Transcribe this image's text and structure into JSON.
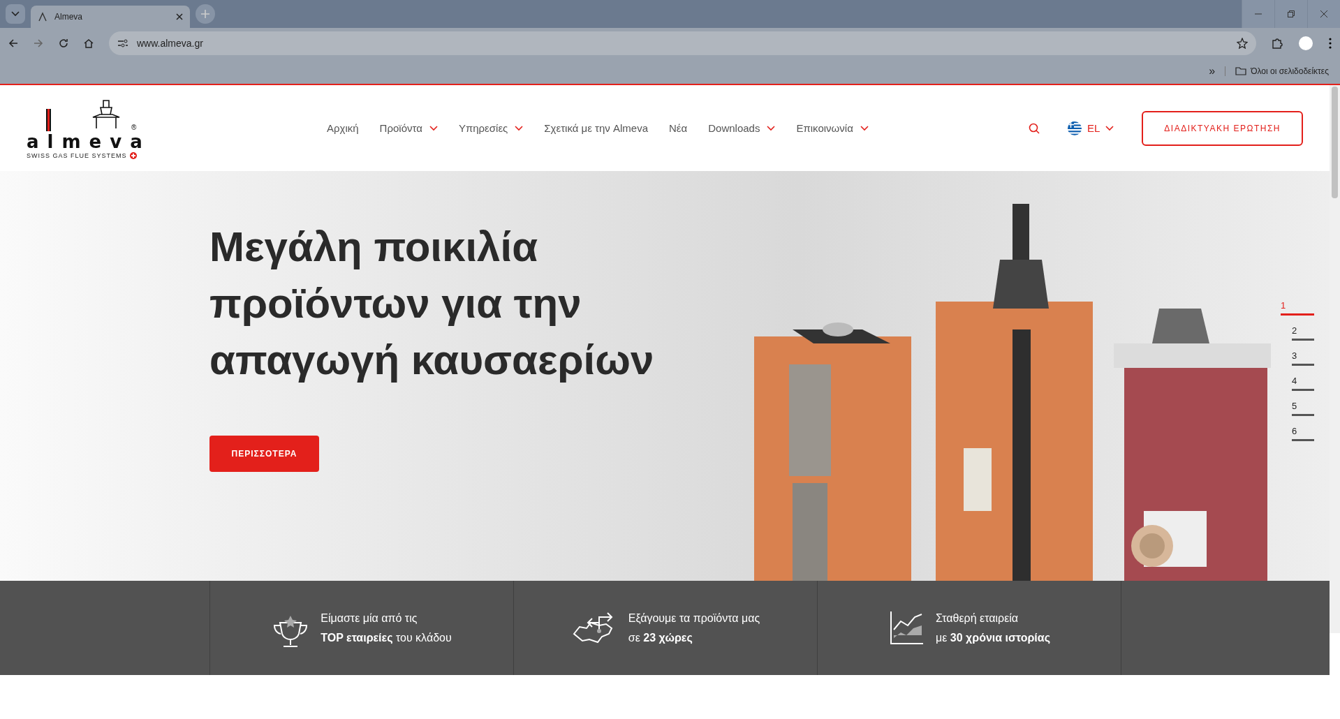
{
  "browser": {
    "tab_title": "Almeva",
    "url": "www.almeva.gr",
    "bookmarks_label": "Όλοι οι σελιδοδείκτες",
    "overflow": "»"
  },
  "logo": {
    "wordmark": "almeva",
    "registered": "®",
    "tagline": "SWISS GAS FLUE SYSTEMS"
  },
  "nav": [
    {
      "label": "Αρχική",
      "dropdown": false
    },
    {
      "label": "Προϊόντα",
      "dropdown": true
    },
    {
      "label": "Υπηρεσίες",
      "dropdown": true
    },
    {
      "label": "Σχετικά με την Almeva",
      "dropdown": false
    },
    {
      "label": "Νέα",
      "dropdown": false
    },
    {
      "label": "Downloads",
      "dropdown": true
    },
    {
      "label": "Επικοινωνία",
      "dropdown": true
    }
  ],
  "language": "EL",
  "cta": "ΔΙΑΔΙΚΤΥΑΚΗ ΕΡΩΤΗΣΗ",
  "hero": {
    "title": "Μεγάλη ποικιλία προϊόντων για την απαγωγή καυσαερίων",
    "button": "ΠΕΡΙΣΣΟΤΕΡΑ"
  },
  "slides": [
    {
      "label": "1",
      "selected": true
    },
    {
      "label": "2",
      "selected": false
    },
    {
      "label": "3",
      "selected": false
    },
    {
      "label": "4",
      "selected": false
    },
    {
      "label": "5",
      "selected": false
    },
    {
      "label": "6",
      "selected": false
    }
  ],
  "stats": [
    {
      "kind": "trophy",
      "line1": "Είμαστε μία από τις",
      "line2": "**TOP εταιρείες** του κλάδου"
    },
    {
      "kind": "map",
      "line1": "Εξάγουμε τα προϊόντα μας",
      "line2": "σε **23 χώρες**"
    },
    {
      "kind": "chart",
      "line1": "Σταθερή εταιρεία",
      "line2": "με **30 χρόνια ιστορίας**"
    }
  ]
}
